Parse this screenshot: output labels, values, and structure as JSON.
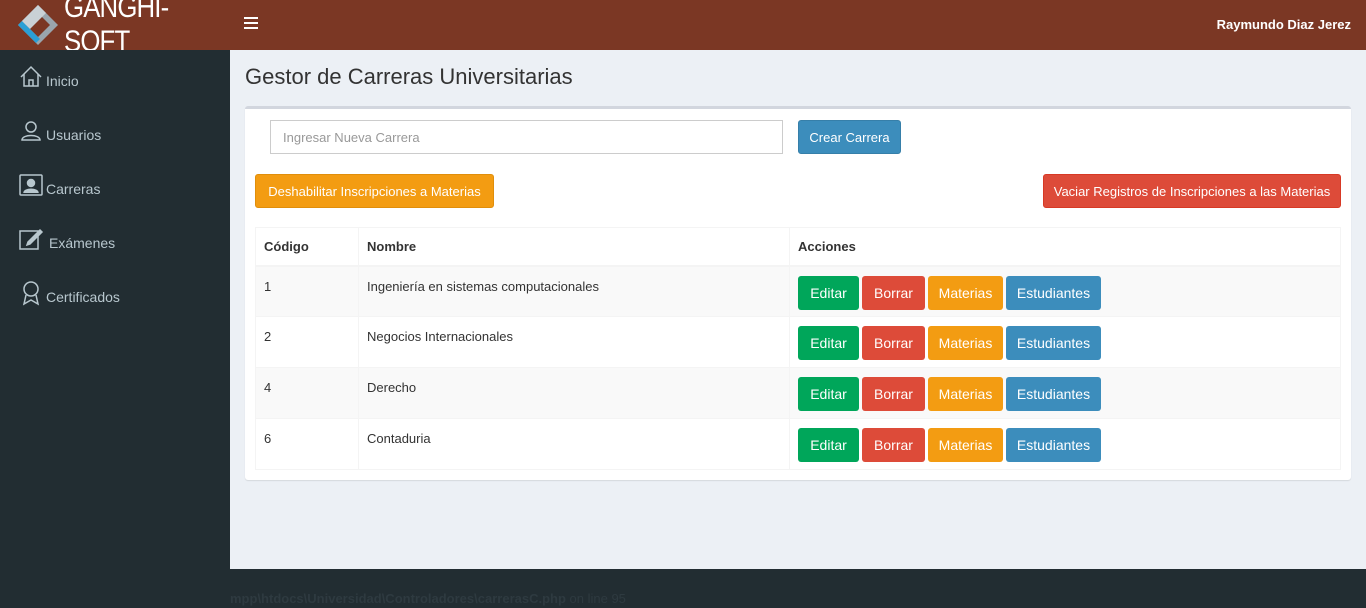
{
  "header": {
    "logo_text": "GANGHI-SOFT",
    "user_name": "Raymundo Diaz Jerez",
    "brand_color": "#7b3724"
  },
  "sidebar": {
    "items": [
      {
        "label": "Inicio",
        "icon": "home-icon"
      },
      {
        "label": "Usuarios",
        "icon": "user-icon"
      },
      {
        "label": "Carreras",
        "icon": "contact-card-icon"
      },
      {
        "label": "Exámenes",
        "icon": "edit-icon"
      },
      {
        "label": "Certificados",
        "icon": "award-icon"
      }
    ]
  },
  "page": {
    "title": "Gestor de Carreras Universitarias",
    "input_placeholder": "Ingresar Nueva Carrera",
    "create_button": "Crear Carrera",
    "disable_button": "Deshabilitar Inscripciones a Materias",
    "clear_button": "Vaciar Registros de Inscripciones a las Materias"
  },
  "table": {
    "columns": [
      "Código",
      "Nombre",
      "Acciones"
    ],
    "rows": [
      {
        "codigo": "1",
        "nombre": "Ingeniería en sistemas computacionales"
      },
      {
        "codigo": "2",
        "nombre": "Negocios Internacionales"
      },
      {
        "codigo": "4",
        "nombre": "Derecho"
      },
      {
        "codigo": "6",
        "nombre": "Contaduria"
      }
    ],
    "action_labels": {
      "edit": "Editar",
      "delete": "Borrar",
      "subjects": "Materias",
      "students": "Estudiantes"
    }
  },
  "footer": {
    "text_prefix": "mpp\\htdocs\\Universidad\\Controladores\\carrerasC.php",
    "text_suffix": " on line 95"
  }
}
